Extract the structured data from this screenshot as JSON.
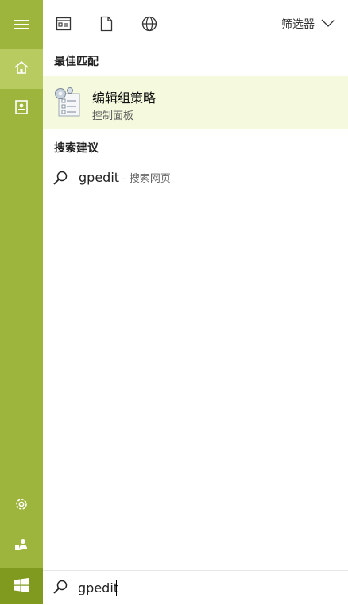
{
  "rail": {
    "items": [
      {
        "icon": "hamburger-menu-icon"
      },
      {
        "icon": "home-icon"
      },
      {
        "icon": "notebook-icon"
      },
      {
        "icon": "settings-gear-icon"
      },
      {
        "icon": "feedback-icon"
      },
      {
        "icon": "windows-start-icon"
      }
    ]
  },
  "topbar": {
    "icons": [
      "apps-icon",
      "documents-icon",
      "web-globe-icon"
    ],
    "filter_label": "筛选器"
  },
  "best_match": {
    "heading": "最佳匹配",
    "title": "编辑组策略",
    "subtitle": "控制面板"
  },
  "suggestions": {
    "heading": "搜索建议",
    "items": [
      {
        "query": "gpedit",
        "hint": "- 搜索网页"
      }
    ]
  },
  "search": {
    "value": "gpedit"
  },
  "colors": {
    "rail": "#9db53c",
    "rail_active": "#b7cb60",
    "start": "#7f9a1e",
    "best_match_bg": "#f5f9de"
  }
}
